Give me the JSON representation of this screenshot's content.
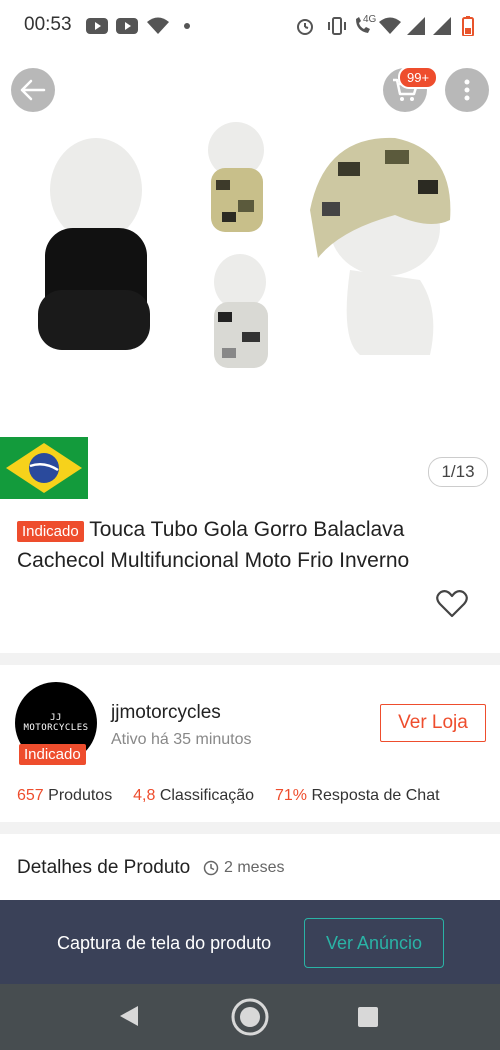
{
  "status_bar": {
    "time": "00:53",
    "network": "4G"
  },
  "header": {
    "cart_badge": "99+"
  },
  "gallery": {
    "counter": "1/13"
  },
  "product": {
    "tag": "Indicado",
    "title": "Touca Tubo Gola Gorro Balaclava Cachecol Multifuncional Moto Frio Inverno"
  },
  "shop": {
    "name": "jjmotorcycles",
    "active": "Ativo há 35 minutos",
    "tag": "Indicado",
    "view_button": "Ver Loja",
    "logo_text": "JJ MOTORCYCLES",
    "stats": [
      {
        "value": "657",
        "label": "Produtos"
      },
      {
        "value": "4,8",
        "label": "Classificação"
      },
      {
        "value": "71%",
        "label": "Resposta de Chat"
      }
    ]
  },
  "details": {
    "label": "Detalhes de Produto",
    "time": "2 meses"
  },
  "capture": {
    "label": "Captura de tela do produto",
    "button": "Ver Anúncio"
  },
  "colors": {
    "accent": "#ee4d2d",
    "teal": "#2ab3a6",
    "bar": "#3a4158"
  }
}
